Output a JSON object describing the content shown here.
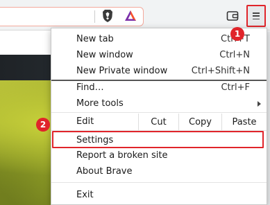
{
  "toolbar": {
    "icons": [
      "brave-shield-icon",
      "bat-triangle-icon",
      "wallet-icon",
      "hamburger-menu-icon"
    ]
  },
  "menu": {
    "items": [
      {
        "label": "New tab",
        "shortcut": "Ctrl+T"
      },
      {
        "label": "New window",
        "shortcut": "Ctrl+N"
      },
      {
        "label": "New Private window",
        "shortcut": "Ctrl+Shift+N"
      },
      {
        "label": "Find…",
        "shortcut": "Ctrl+F"
      },
      {
        "label": "More tools",
        "shortcut": ""
      },
      {
        "label": "Edit",
        "shortcut": ""
      },
      {
        "label": "Settings",
        "shortcut": ""
      },
      {
        "label": "Report a broken site",
        "shortcut": ""
      },
      {
        "label": "About Brave",
        "shortcut": ""
      },
      {
        "label": "Exit",
        "shortcut": ""
      }
    ],
    "edit_actions": {
      "cut": "Cut",
      "copy": "Copy",
      "paste": "Paste"
    }
  },
  "annotations": {
    "step1": "1",
    "step2": "2"
  },
  "colors": {
    "highlight": "#e0242a",
    "brave_orange": "#fb542b"
  }
}
